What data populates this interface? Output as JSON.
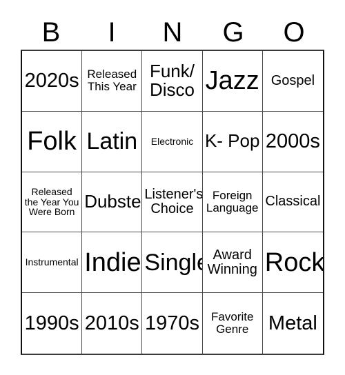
{
  "card": {
    "header": {
      "letters": [
        "B",
        "I",
        "N",
        "G",
        "O"
      ]
    },
    "grid": {
      "rows": 5,
      "columns": 5,
      "cells": [
        {
          "text": "2020s",
          "size": "lg"
        },
        {
          "text": "Released This Year",
          "size": "xs"
        },
        {
          "text": "Funk/ Disco",
          "size": "md"
        },
        {
          "text": "Jazz",
          "size": "xxl"
        },
        {
          "text": "Gospel",
          "size": "sm"
        },
        {
          "text": "Folk",
          "size": "xxl"
        },
        {
          "text": "Latin",
          "size": "xl"
        },
        {
          "text": "Electronic",
          "size": "xxs"
        },
        {
          "text": "K- Pop",
          "size": "md"
        },
        {
          "text": "2000s",
          "size": "lg"
        },
        {
          "text": "Released the Year You Were Born",
          "size": "xxs"
        },
        {
          "text": "Dubstep",
          "size": "md"
        },
        {
          "text": "Listener's Choice",
          "size": "sm"
        },
        {
          "text": "Foreign Language",
          "size": "xs"
        },
        {
          "text": "Classical",
          "size": "sm"
        },
        {
          "text": "Instrumental",
          "size": "xxs"
        },
        {
          "text": "Indie",
          "size": "xxl"
        },
        {
          "text": "Single",
          "size": "xl"
        },
        {
          "text": "Award Winning",
          "size": "sm"
        },
        {
          "text": "Rock",
          "size": "xxl"
        },
        {
          "text": "1990s",
          "size": "lg"
        },
        {
          "text": "2010s",
          "size": "lg"
        },
        {
          "text": "1970s",
          "size": "lg"
        },
        {
          "text": "Favorite Genre",
          "size": "xs"
        },
        {
          "text": "Metal",
          "size": "lg"
        }
      ]
    },
    "colors": {
      "background": "#ffffff",
      "text": "#000000",
      "grid_line": "#4a4a4a",
      "grid_outer": "#111111"
    }
  }
}
